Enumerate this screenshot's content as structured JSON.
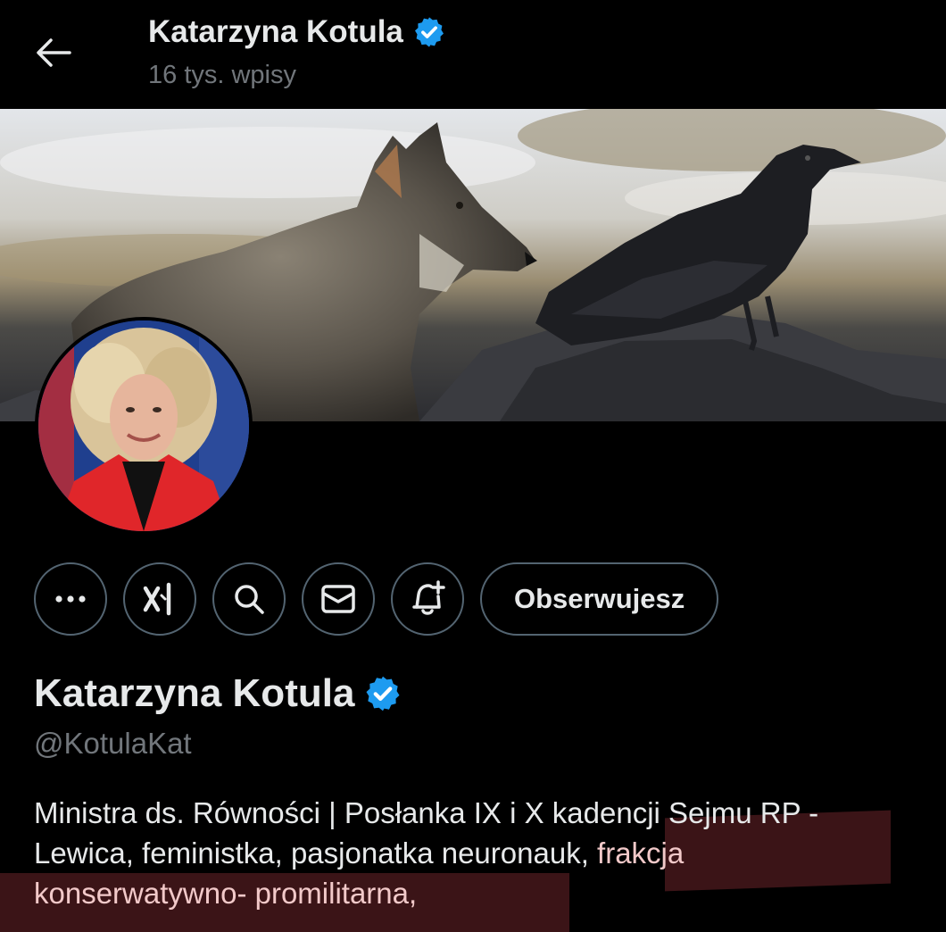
{
  "header": {
    "title": "Katarzyna Kotula",
    "post_count": "16 tys. wpisy"
  },
  "profile": {
    "display_name": "Katarzyna Kotula",
    "handle": "@KotulaKat",
    "bio_lines": [
      "Ministra ds. Równości | Posłanka IX i X kadencji Sejmu RP -",
      "Lewica, feministka, pasjonatka neuronauk,",
      "frakcja",
      "konserwatywno- promilitarna,"
    ]
  },
  "actions": {
    "more_icon": "more-icon",
    "grok_icon": "grok-icon",
    "search_icon": "search-icon",
    "message_icon": "envelope-icon",
    "notify_icon": "bell-plus-icon",
    "follow_label": "Obserwujesz"
  },
  "colors": {
    "background": "#000000",
    "text": "#e7e9ea",
    "secondary_text": "#71767b",
    "verified_blue": "#1d9bf0",
    "button_border": "#536471",
    "highlight": "#3b1417"
  }
}
